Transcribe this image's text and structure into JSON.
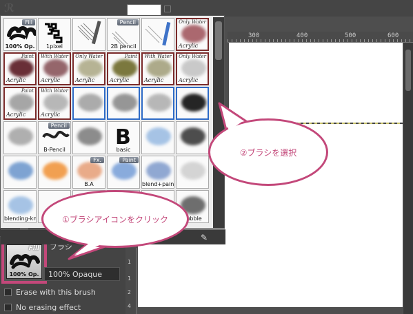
{
  "palette": {
    "cells": [
      {
        "label": "",
        "tag": "Fill",
        "sub": "100% Op.",
        "kind": "fill"
      },
      {
        "label": "1pixel",
        "tag": "",
        "kind": "pixel"
      },
      {
        "label": "",
        "tag": "",
        "kind": "pencil-sketch"
      },
      {
        "label": "2B pencil",
        "tag": "Pencil",
        "kind": "pencil"
      },
      {
        "label": "",
        "tag": "",
        "kind": "pencil-blue"
      },
      {
        "label": "Acrylic",
        "tag": "Only Water",
        "kind": "acrylic-red"
      },
      {
        "label": "Acrylic",
        "tag": "Paint",
        "kind": "acrylic-dark"
      },
      {
        "label": "Acrylic",
        "tag": "With Water",
        "kind": "acrylic-dark2"
      },
      {
        "label": "Acrylic",
        "tag": "Only Water",
        "kind": "acrylic-olive"
      },
      {
        "label": "Acrylic",
        "tag": "Paint",
        "kind": "acrylic-olive2"
      },
      {
        "label": "Acrylic",
        "tag": "With Water",
        "kind": "acrylic-olive3"
      },
      {
        "label": "Acrylic",
        "tag": "Only Water",
        "kind": "acrylic-grey"
      },
      {
        "label": "Acrylic",
        "tag": "Paint",
        "kind": "squiggle"
      },
      {
        "label": "Acrylic",
        "tag": "With Water",
        "kind": "squiggle2"
      },
      {
        "label": "",
        "tag": "",
        "kind": "swirl"
      },
      {
        "label": "",
        "tag": "",
        "kind": "airbrush"
      },
      {
        "label": "",
        "tag": "",
        "kind": "soft"
      },
      {
        "label": "",
        "tag": "",
        "kind": "black-soft"
      },
      {
        "label": "",
        "tag": "",
        "kind": "curve"
      },
      {
        "label": "B-Pencil",
        "tag": "Pencil",
        "kind": "bpencil"
      },
      {
        "label": "",
        "tag": "",
        "kind": "scribble-pencil"
      },
      {
        "label": "basic",
        "tag": "",
        "kind": "basic"
      },
      {
        "label": "",
        "tag": "",
        "kind": "blue-blur"
      },
      {
        "label": "",
        "tag": "",
        "kind": "pen-black"
      },
      {
        "label": "",
        "tag": "",
        "kind": "blue-knife"
      },
      {
        "label": "",
        "tag": "",
        "kind": "orange-knife"
      },
      {
        "label": "B.A",
        "tag": "Fx.",
        "kind": "fx"
      },
      {
        "label": "",
        "tag": "Paint",
        "kind": "paint-blue"
      },
      {
        "label": "blend+paint",
        "tag": "",
        "kind": "blend"
      },
      {
        "label": "",
        "tag": "",
        "kind": "drop"
      },
      {
        "label": "blending-knife",
        "tag": "",
        "kind": "blending-knife"
      },
      {
        "label": "",
        "tag": "",
        "kind": "empty"
      },
      {
        "label": "",
        "tag": "",
        "kind": "empty"
      },
      {
        "label": "",
        "tag": "",
        "kind": "empty"
      },
      {
        "label": "",
        "tag": "",
        "kind": "empty"
      },
      {
        "label": "bubble",
        "tag": "",
        "kind": "bubble"
      }
    ]
  },
  "ruler": {
    "ticks": [
      "300",
      "400",
      "500",
      "600"
    ],
    "vticks": [
      "1",
      "1",
      "2",
      "4"
    ]
  },
  "panel": {
    "brush_label_partial": "ブラシ",
    "selected_tag": "Fill",
    "selected_sub": "100% Op.",
    "opacity_value": "100% Opaque",
    "checks": [
      "Erase with this brush",
      "No erasing effect"
    ]
  },
  "callouts": {
    "select_brush": "②ブラシを選択",
    "click_icon": "①ブラシアイコンをクリック"
  },
  "colors": {
    "accent": "#c3487a",
    "selection": "#2f6bc6"
  }
}
